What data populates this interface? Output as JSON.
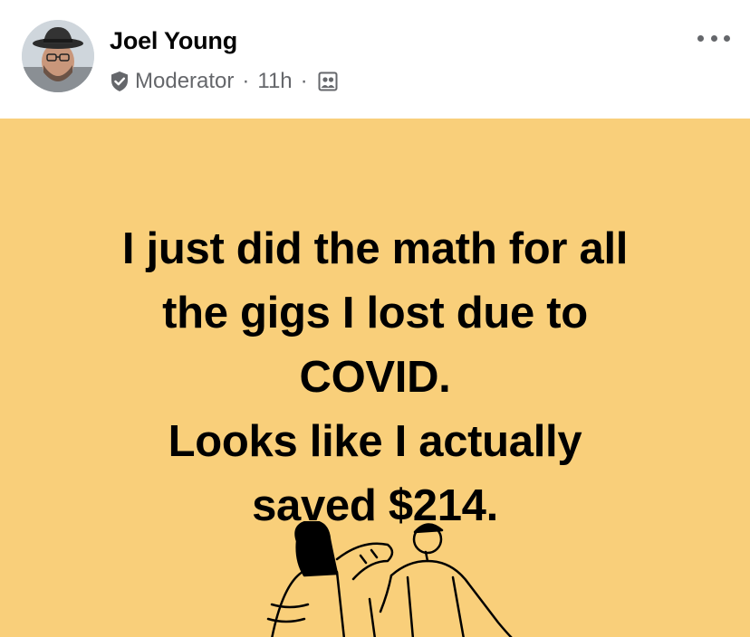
{
  "post": {
    "author": "Joel Young",
    "role": "Moderator",
    "separator": "·",
    "time": "11h",
    "icons": {
      "avatar": "profile-photo",
      "role_badge": "moderator-shield-icon",
      "audience": "group-members-icon",
      "more": "more-options-icon"
    },
    "background_color": "#f9cf7a",
    "message_lines": [
      "I just did the math for all",
      "the gigs I lost due to",
      "COVID.",
      "Looks like I actually",
      "saved $214."
    ]
  }
}
